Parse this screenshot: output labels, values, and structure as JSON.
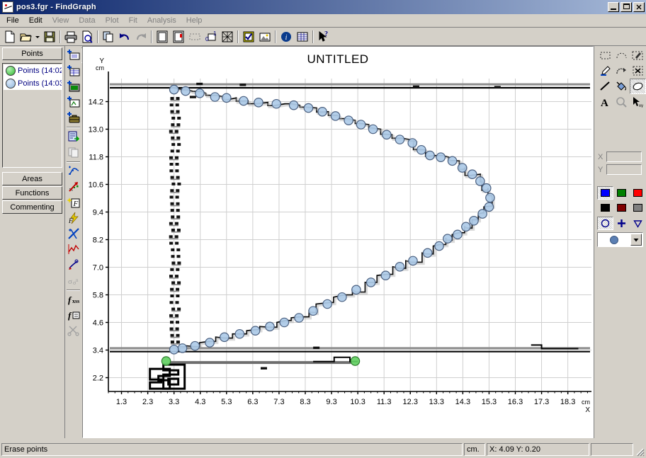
{
  "window": {
    "title": "pos3.fgr - FindGraph",
    "icon": "graph-document-icon",
    "minimize_label": "_",
    "maximize_label": "□",
    "close_label": "✕"
  },
  "menu": {
    "items": [
      {
        "label": "File",
        "enabled": true
      },
      {
        "label": "Edit",
        "enabled": true
      },
      {
        "label": "View",
        "enabled": false
      },
      {
        "label": "Data",
        "enabled": false
      },
      {
        "label": "Plot",
        "enabled": false
      },
      {
        "label": "Fit",
        "enabled": false
      },
      {
        "label": "Analysis",
        "enabled": false
      },
      {
        "label": "Help",
        "enabled": false
      }
    ]
  },
  "main_toolbar": {
    "buttons": [
      {
        "name": "new-document-button",
        "icon": "new-page-icon",
        "tooltip": "New"
      },
      {
        "name": "open-document-button",
        "icon": "open-folder-icon",
        "tooltip": "Open"
      },
      {
        "name": "open-dropdown-button",
        "icon": "chevron-down-icon",
        "tooltip": "Recent"
      },
      {
        "name": "save-button",
        "icon": "floppy-disk-icon",
        "tooltip": "Save"
      },
      {
        "name": "print-button",
        "icon": "printer-icon",
        "tooltip": "Print"
      },
      {
        "name": "print-preview-button",
        "icon": "print-preview-icon",
        "tooltip": "Print Preview"
      },
      {
        "name": "copy-button",
        "icon": "copy-icon",
        "tooltip": "Copy"
      },
      {
        "name": "undo-button",
        "icon": "undo-arrow-icon",
        "tooltip": "Undo"
      },
      {
        "name": "redo-button",
        "icon": "redo-arrow-icon",
        "tooltip": "Redo"
      },
      {
        "name": "new-sheet-button",
        "icon": "white-page-icon",
        "tooltip": "New Sheet"
      },
      {
        "name": "import-sheet-button",
        "icon": "page-import-icon",
        "tooltip": "Import"
      },
      {
        "name": "selection-button",
        "icon": "dotted-rect-icon",
        "tooltip": "Select"
      },
      {
        "name": "zero-one-button",
        "icon": "zero-one-icon",
        "tooltip": "Normalize"
      },
      {
        "name": "clear-grid-button",
        "icon": "crossed-box-icon",
        "tooltip": "Clear"
      },
      {
        "name": "wizard-button",
        "icon": "checklist-icon",
        "tooltip": "Wizard"
      },
      {
        "name": "image-button",
        "icon": "picture-icon",
        "tooltip": "Digitize Image"
      },
      {
        "name": "info-button",
        "icon": "info-circle-icon",
        "tooltip": "About"
      },
      {
        "name": "table-button",
        "icon": "table-grid-icon",
        "tooltip": "Table"
      },
      {
        "name": "help-pointer-button",
        "icon": "help-arrow-icon",
        "tooltip": "Context Help"
      }
    ]
  },
  "points_toolbar": {
    "buttons": [
      {
        "name": "points-mode-button",
        "icon": "points-edit-icon",
        "pressed": true
      },
      {
        "name": "add-points-button",
        "icon": "scatter-add-icon",
        "pressed": false
      },
      {
        "name": "delete-points-button",
        "icon": "cross-line-icon",
        "pressed": false
      },
      {
        "name": "erase-points-button",
        "icon": "hatched-cross-icon",
        "pressed": false
      },
      {
        "name": "pen-tool-button",
        "icon": "pen-icon",
        "pressed": false
      },
      {
        "name": "noise-filter-button",
        "icon": "noise-grid-icon",
        "pressed": false
      },
      {
        "name": "gear-tool-button",
        "icon": "gears-icon",
        "pressed": false
      },
      {
        "name": "network-points-button",
        "icon": "network-points-icon",
        "pressed": false
      },
      {
        "name": "back-arrow-button",
        "icon": "left-arrow-icon",
        "pressed": false
      },
      {
        "name": "image-layer-button",
        "icon": "image-layer-icon",
        "pressed": true
      },
      {
        "name": "legend-button",
        "icon": "legend-icon",
        "pressed": false
      }
    ]
  },
  "left_panel": {
    "tab_label": "Points",
    "series": [
      {
        "label": "Points (14:02",
        "color": "#63d063",
        "marker": "green-circle-marker"
      },
      {
        "label": "Points (14:03",
        "color": "#aecbe8",
        "marker": "blue-circle-marker"
      }
    ],
    "buttons": [
      {
        "label": "Areas",
        "name": "areas-button"
      },
      {
        "label": "Functions",
        "name": "functions-button"
      },
      {
        "label": "Commenting",
        "name": "commenting-button"
      }
    ]
  },
  "vertical_toolbar": {
    "buttons": [
      {
        "name": "add-points-series-button",
        "icon": "add-card-icon"
      },
      {
        "name": "add-table-button",
        "icon": "add-table-icon"
      },
      {
        "name": "add-screen-button",
        "icon": "add-monitor-icon"
      },
      {
        "name": "add-window-button",
        "icon": "add-window-icon"
      },
      {
        "name": "add-archive-button",
        "icon": "add-briefcase-icon"
      },
      {
        "name": "export-data-button",
        "icon": "page-export-icon"
      },
      {
        "name": "duplicate-data-button",
        "icon": "duplicate-page-icon"
      },
      {
        "name": "smooth-curve-button",
        "icon": "spline-icon"
      },
      {
        "name": "interpolate-button",
        "icon": "red-arrow-scatter-icon"
      },
      {
        "name": "fit-function-button",
        "icon": "star-f-icon"
      },
      {
        "name": "quick-fit-button",
        "icon": "lightning-f-icon"
      },
      {
        "name": "cross-fit-button",
        "icon": "crossed-pen-icon"
      },
      {
        "name": "line-chart-button",
        "icon": "zigzag-line-icon"
      },
      {
        "name": "annotate-button",
        "icon": "hand-write-icon"
      },
      {
        "name": "stat-button",
        "icon": "sigma-stat-icon"
      },
      {
        "name": "fx-library-button",
        "icon": "fx-icon"
      },
      {
        "name": "f-list-button",
        "icon": "f-list-icon"
      },
      {
        "name": "scissors-button",
        "icon": "scissors-icon"
      }
    ]
  },
  "right_panel": {
    "tools": [
      {
        "name": "rect-select-tool",
        "icon": "dotted-rect-icon",
        "pressed": false
      },
      {
        "name": "lasso-select-tool",
        "icon": "dotted-arc-icon",
        "pressed": false
      },
      {
        "name": "freehand-tool",
        "icon": "pencil-box-icon",
        "pressed": false
      },
      {
        "name": "eyedropper-tool",
        "icon": "eyedropper-icon",
        "pressed": false
      },
      {
        "name": "curve-tool",
        "icon": "curve-arrow-icon",
        "pressed": false
      },
      {
        "name": "delete-selection-tool",
        "icon": "boxed-x-icon",
        "pressed": false
      },
      {
        "name": "line-tool",
        "icon": "diagonal-line-icon",
        "pressed": false
      },
      {
        "name": "fill-tool",
        "icon": "paint-bucket-icon",
        "pressed": false
      },
      {
        "name": "eraser-tool",
        "icon": "eraser-icon",
        "pressed": true
      },
      {
        "name": "text-tool",
        "icon": "text-a-icon",
        "pressed": false
      },
      {
        "name": "zoom-tool",
        "icon": "magnifier-icon",
        "pressed": false
      },
      {
        "name": "pointer-xy-tool",
        "icon": "arrow-xy-icon",
        "pressed": false
      }
    ],
    "coords": {
      "x_label": "X",
      "y_label": "Y",
      "x_value": "",
      "y_value": ""
    },
    "palette_row1": [
      "#0000ff",
      "#008000",
      "#ff0000"
    ],
    "palette_row2": [
      "#000000",
      "#800000",
      "#808080"
    ],
    "markers": [
      {
        "name": "circle-marker-button",
        "icon": "circle-outline-icon",
        "pressed": true
      },
      {
        "name": "plus-marker-button",
        "icon": "plus-marker-icon",
        "pressed": false
      },
      {
        "name": "triangle-marker-button",
        "icon": "triangle-down-icon",
        "pressed": false
      }
    ],
    "marker_combo": {
      "name": "marker-style-combo",
      "selected_icon": "filled-circle-icon",
      "selected_color": "#5b7fb3",
      "arrow": "chevron-down-icon"
    }
  },
  "status_bar": {
    "message": "Erase points",
    "units": "cm.",
    "coordinates": "X:  4.09     Y:  0.20",
    "extra": ""
  },
  "chart_data": {
    "type": "scatter",
    "title": "UNTITLED",
    "xlabel": "X",
    "ylabel": "Y",
    "x_unit": "cm",
    "y_unit": "cm",
    "xlim": [
      0.8,
      19.2
    ],
    "ylim": [
      1.6,
      15.2
    ],
    "xticks": [
      1.3,
      2.3,
      3.3,
      4.3,
      5.3,
      6.3,
      7.3,
      8.3,
      9.3,
      10.3,
      11.3,
      12.3,
      13.3,
      14.3,
      15.3,
      16.3,
      17.3,
      18.3
    ],
    "yticks": [
      2.2,
      3.4,
      4.6,
      5.8,
      7.0,
      8.2,
      9.4,
      10.6,
      11.8,
      13.0,
      14.2
    ],
    "grid": true,
    "legend": false,
    "series": [
      {
        "name": "Points (14:03",
        "marker": "circle",
        "color": "#aecbe8",
        "edge_color": "#4a5f7f",
        "points": [
          [
            3.3,
            14.72
          ],
          [
            3.74,
            14.66
          ],
          [
            4.28,
            14.56
          ],
          [
            4.86,
            14.4
          ],
          [
            5.3,
            14.36
          ],
          [
            5.95,
            14.23
          ],
          [
            6.52,
            14.16
          ],
          [
            7.2,
            14.1
          ],
          [
            7.86,
            14.04
          ],
          [
            8.42,
            13.92
          ],
          [
            8.95,
            13.76
          ],
          [
            9.45,
            13.57
          ],
          [
            9.95,
            13.38
          ],
          [
            10.42,
            13.2
          ],
          [
            10.88,
            13.0
          ],
          [
            11.4,
            12.76
          ],
          [
            11.9,
            12.55
          ],
          [
            12.38,
            12.4
          ],
          [
            12.72,
            12.1
          ],
          [
            13.05,
            11.86
          ],
          [
            13.46,
            11.78
          ],
          [
            13.9,
            11.62
          ],
          [
            14.28,
            11.32
          ],
          [
            14.66,
            11.04
          ],
          [
            14.96,
            10.74
          ],
          [
            15.2,
            10.44
          ],
          [
            15.34,
            10.02
          ],
          [
            15.3,
            9.62
          ],
          [
            15.05,
            9.32
          ],
          [
            14.72,
            9.02
          ],
          [
            14.42,
            8.76
          ],
          [
            14.1,
            8.42
          ],
          [
            13.72,
            8.24
          ],
          [
            13.4,
            7.92
          ],
          [
            12.96,
            7.62
          ],
          [
            12.4,
            7.28
          ],
          [
            11.9,
            7.02
          ],
          [
            11.36,
            6.64
          ],
          [
            10.8,
            6.34
          ],
          [
            10.24,
            6.02
          ],
          [
            9.7,
            5.7
          ],
          [
            9.14,
            5.4
          ],
          [
            8.6,
            5.1
          ],
          [
            8.06,
            4.8
          ],
          [
            7.5,
            4.6
          ],
          [
            6.95,
            4.42
          ],
          [
            6.4,
            4.24
          ],
          [
            5.8,
            4.1
          ],
          [
            5.22,
            3.96
          ],
          [
            4.66,
            3.72
          ],
          [
            4.1,
            3.58
          ],
          [
            3.62,
            3.48
          ],
          [
            3.3,
            3.42
          ]
        ]
      },
      {
        "name": "Points (14:02",
        "marker": "circle",
        "color": "#63d063",
        "edge_color": "#2e7d2e",
        "points": [
          [
            3.0,
            2.92
          ],
          [
            10.2,
            2.92
          ]
        ]
      }
    ],
    "annotations": [
      {
        "text": "3d",
        "x": 3.3,
        "y": 2.15,
        "style": "bitmap-outline"
      }
    ]
  }
}
